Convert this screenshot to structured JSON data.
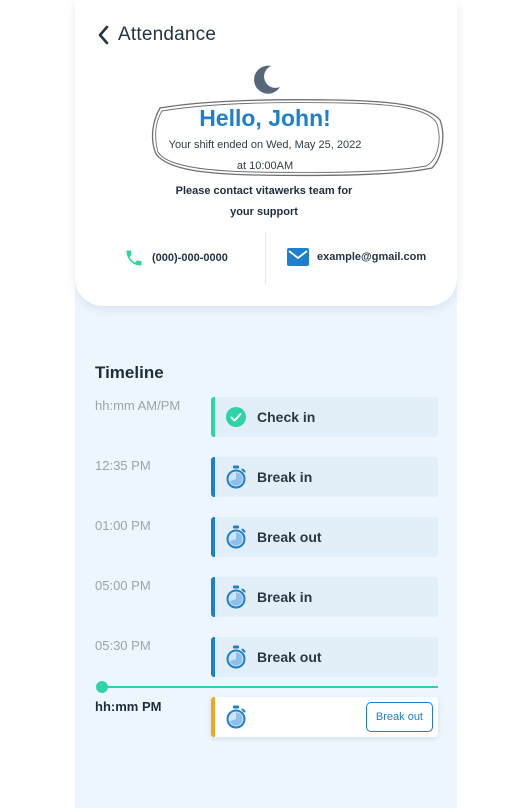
{
  "header": {
    "back_icon": "chevron-left-icon",
    "title": "Attendance"
  },
  "greeting": {
    "moon_icon": "moon-icon",
    "hello": "Hello, John!",
    "shift_line_1": "Your shift ended on Wed, May 25, 2022",
    "shift_line_2": "at 10:00AM",
    "contact_line_1": "Please contact vitawerks team for",
    "contact_line_2": "your support"
  },
  "contact": {
    "phone": "(000)-000-0000",
    "email": "example@gmail.com",
    "phone_icon": "phone-icon",
    "email_icon": "mail-icon"
  },
  "timeline": {
    "title": "Timeline",
    "events": [
      {
        "time": "hh:mm AM/PM",
        "label": "Check in",
        "icon": "check-circle-icon"
      },
      {
        "time": "12:35 PM",
        "label": "Break in",
        "icon": "stopwatch-icon"
      },
      {
        "time": "01:00 PM",
        "label": "Break out",
        "icon": "stopwatch-icon"
      },
      {
        "time": "05:00 PM",
        "label": "Break in",
        "icon": "stopwatch-icon"
      },
      {
        "time": "05:30 PM",
        "label": "Break out",
        "icon": "stopwatch-icon"
      }
    ],
    "current": {
      "time": "hh:mm PM",
      "icon": "stopwatch-icon",
      "button_label": "Break out"
    }
  },
  "colors": {
    "accent_blue": "#1f7fcf",
    "accent_green": "#2ed3a6",
    "accent_orange": "#f5a524",
    "background_tint": "#eef6fd"
  }
}
